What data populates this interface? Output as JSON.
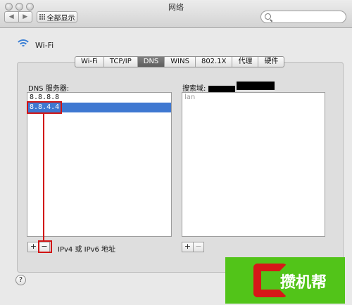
{
  "window": {
    "title": "网络"
  },
  "toolbar": {
    "back_glyph": "◀",
    "forward_glyph": "▶",
    "show_all_label": "全部显示",
    "search_placeholder": ""
  },
  "interface": {
    "name": "Wi-Fi",
    "icon": "wifi-icon",
    "accent": "#3a7fd5"
  },
  "tabs": [
    {
      "label": "Wi-Fi"
    },
    {
      "label": "TCP/IP"
    },
    {
      "label": "DNS",
      "active": true
    },
    {
      "label": "WINS"
    },
    {
      "label": "802.1X"
    },
    {
      "label": "代理"
    },
    {
      "label": "硬件"
    }
  ],
  "dns": {
    "label": "DNS 服务器:",
    "servers": [
      "8.8.8.8",
      "8.8.4.4"
    ],
    "selected_index": 1,
    "hint": "IPv4 或 IPv6 地址"
  },
  "search_domains": {
    "label": "搜索域:",
    "items": [
      "lan"
    ]
  },
  "controls": {
    "add": "+",
    "remove": "−",
    "help": "?"
  },
  "watermark": {
    "letter": "C",
    "text": "攒机帮"
  },
  "colors": {
    "selection": "#3f78d1",
    "highlight": "#d11414",
    "logo_bg": "#52c419"
  }
}
